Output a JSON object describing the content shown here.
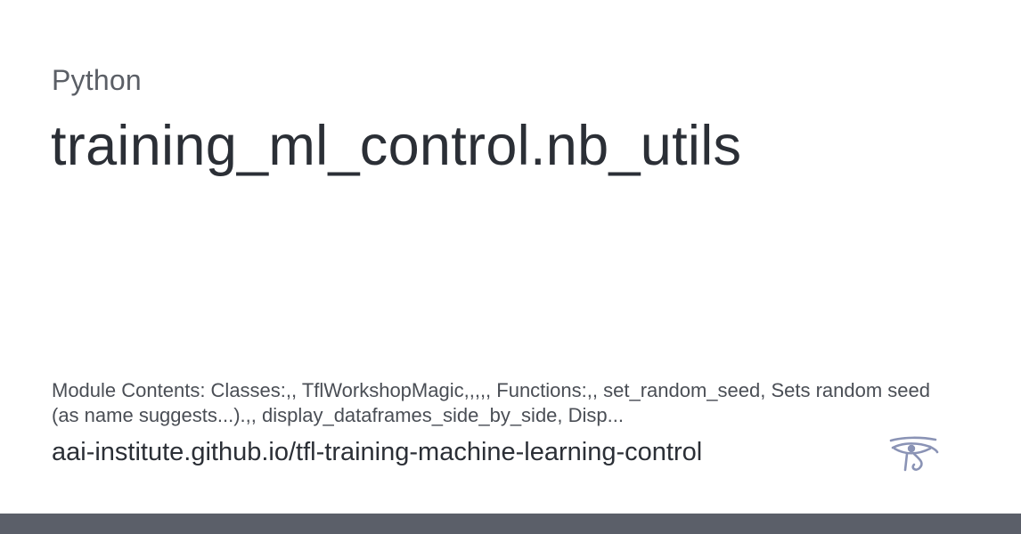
{
  "card": {
    "category": "Python",
    "title": "training_ml_control.nb_utils",
    "description": "Module Contents: Classes:,, TflWorkshopMagic,,,,, Functions:,, set_random_seed, Sets random seed (as name suggests...).,, display_dataframes_side_by_side, Disp...",
    "url": "aai-institute.github.io/tfl-training-machine-learning-control",
    "logo_icon": "eye-of-horus-icon"
  },
  "colors": {
    "footer_bar": "#5b5f69",
    "logo": "#8a93b5"
  }
}
